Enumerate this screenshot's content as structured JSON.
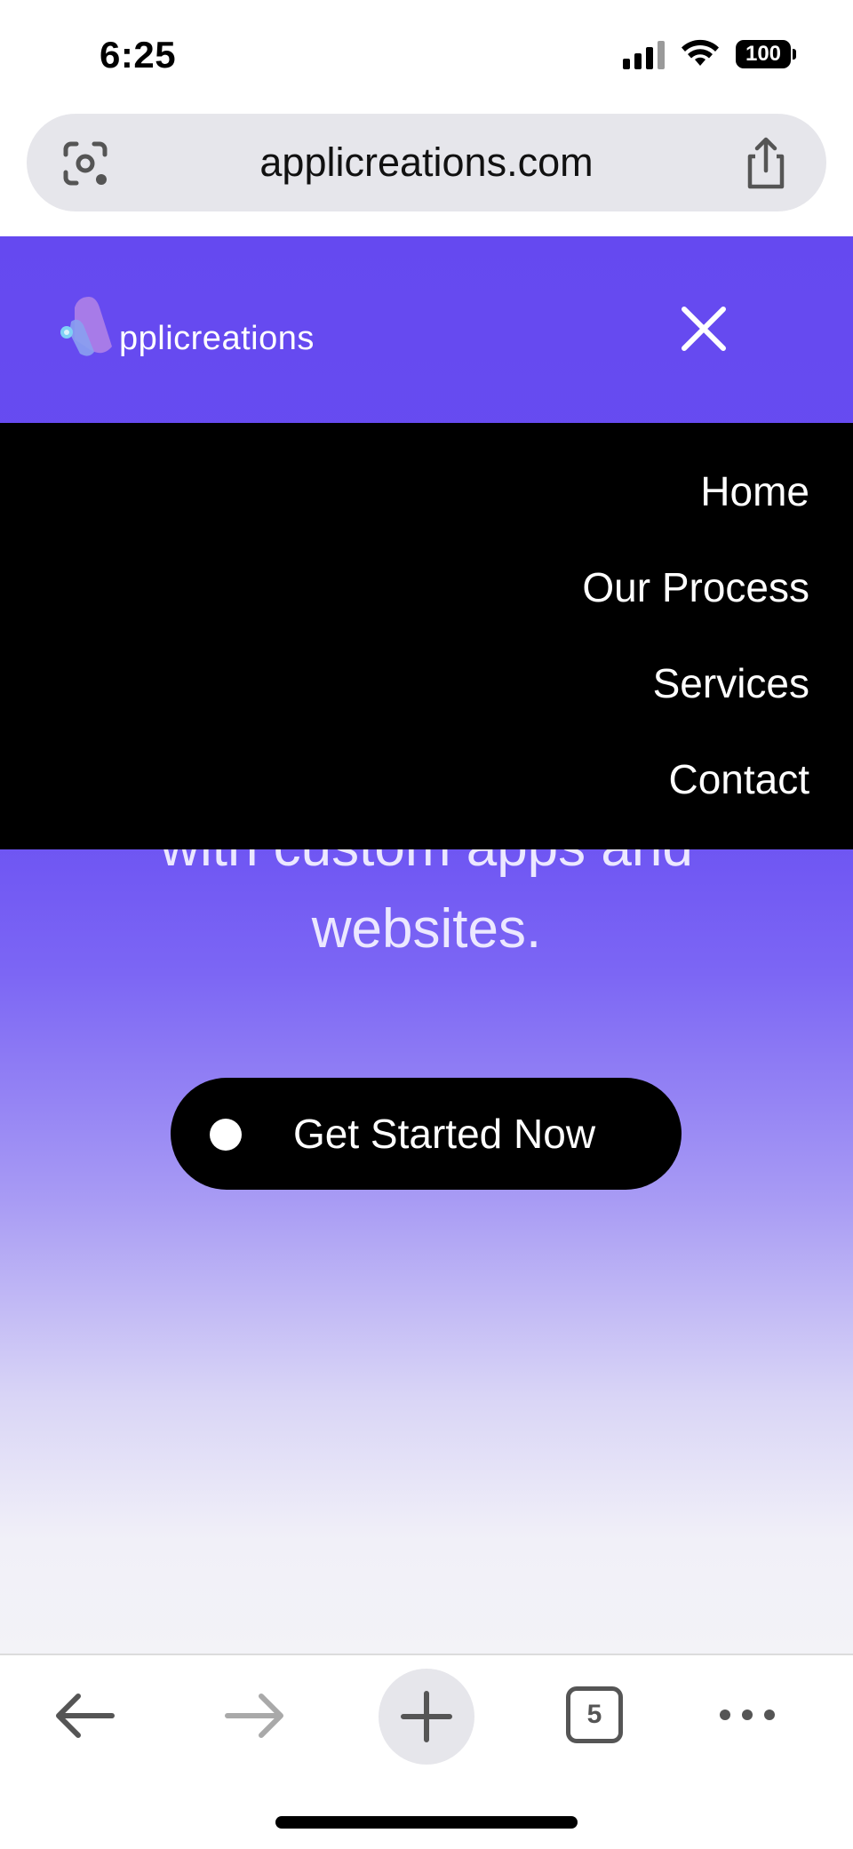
{
  "status_bar": {
    "time": "6:25",
    "battery": "100",
    "icons": [
      "signal-icon",
      "wifi-icon",
      "battery-icon"
    ]
  },
  "browser": {
    "url": "applicreations.com",
    "left_icon": "lens-camera-icon",
    "right_icon": "share-icon",
    "tab_count": "5"
  },
  "site": {
    "logo_text": "pplicreations",
    "menu": [
      {
        "label": "Home"
      },
      {
        "label": "Our Process"
      },
      {
        "label": "Services"
      },
      {
        "label": "Contact"
      }
    ],
    "headline_line1": "with custom apps and",
    "headline_line2": "websites.",
    "cta_label": "Get Started Now"
  },
  "colors": {
    "brand_purple": "#6549F0",
    "menu_bg": "#000000",
    "text_white": "#FFFFFF"
  }
}
